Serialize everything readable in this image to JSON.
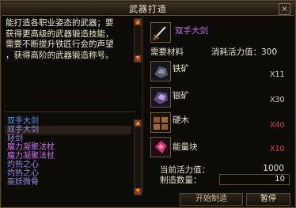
{
  "window": {
    "title": "武器打造",
    "close": "×"
  },
  "description": {
    "lines": [
      "能打造各职业姿态的武器；要",
      "获得更高级的武器锻造技能，",
      "需要不断提升铁匠行会的声望",
      "，获得高阶的武器锻造称号。"
    ]
  },
  "recipes": [
    {
      "label": "双手大剑",
      "color": "#4d9ef6"
    },
    {
      "label": "双手大剑",
      "color": "#9a8cf0",
      "selected": true
    },
    {
      "label": "轻剑",
      "color": "#9a8cf0"
    },
    {
      "label": "魔力凝聚法杖",
      "color": "#c76ff0"
    },
    {
      "label": "魔力凝聚法杖",
      "color": "#c76ff0"
    },
    {
      "label": "灼热之心",
      "color": "#9a8cf0"
    },
    {
      "label": "灼热之心",
      "color": "#9a8cf0"
    },
    {
      "label": "巫妖微骨",
      "color": "#9a8cf0"
    }
  ],
  "product": {
    "name": "双手大剑",
    "name_color": "#c76ff0",
    "icon": "sword-icon"
  },
  "materials_header": {
    "label": "需要材料",
    "cost_label": "消耗活力值：300"
  },
  "materials": [
    {
      "name": "铁矿",
      "count": "X11",
      "count_color": "#d8d0b0",
      "icon": "iron-ore-icon"
    },
    {
      "name": "银矿",
      "count": "X30",
      "count_color": "#d8d0b0",
      "icon": "silver-ore-icon"
    },
    {
      "name": "硬木",
      "count": "X40",
      "count_color": "#e0402a",
      "icon": "hardwood-icon"
    },
    {
      "name": "能量块",
      "count": "X10",
      "count_color": "#e0402a",
      "icon": "energy-block-icon"
    }
  ],
  "stats": {
    "energy_label": "当前活力值：",
    "energy_value": "1000",
    "qty_label": "制造数量：",
    "qty_value": "10"
  },
  "buttons": {
    "start": "开始制造",
    "pause": "暂停"
  }
}
